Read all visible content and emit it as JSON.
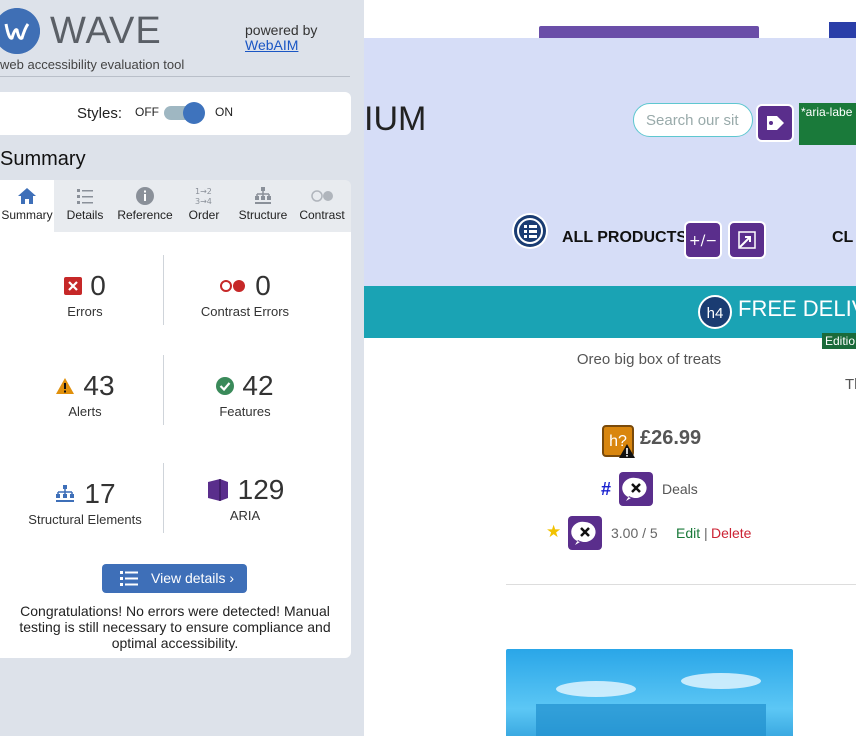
{
  "wave": {
    "title": "WAVE",
    "subtitle": "web accessibility evaluation tool",
    "powered_by": "powered by",
    "powered_by_link": "WebAIM",
    "styles_label": "Styles:",
    "styles_off": "OFF",
    "styles_on": "ON",
    "styles_enabled": true,
    "summary_heading": "Summary",
    "tabs": [
      {
        "label": "Summary",
        "icon": "home-icon",
        "active": true
      },
      {
        "label": "Details",
        "icon": "list-icon"
      },
      {
        "label": "Reference",
        "icon": "info-icon"
      },
      {
        "label": "Order",
        "icon": "order-icon"
      },
      {
        "label": "Structure",
        "icon": "structure-icon"
      },
      {
        "label": "Contrast",
        "icon": "contrast-icon"
      }
    ],
    "stats": {
      "errors": {
        "value": "0",
        "label": "Errors"
      },
      "contrast_errors": {
        "value": "0",
        "label": "Contrast Errors"
      },
      "alerts": {
        "value": "43",
        "label": "Alerts"
      },
      "features": {
        "value": "42",
        "label": "Features"
      },
      "structural": {
        "value": "17",
        "label": "Structural Elements"
      },
      "aria": {
        "value": "129",
        "label": "ARIA"
      }
    },
    "view_details": "View details ›",
    "congrats": "Congratulations! No errors were detected! Manual testing is still necessary to ensure compliance and optimal accessibility."
  },
  "site": {
    "brand_partial": "IUM",
    "search_placeholder": "Search our sit",
    "aria_label_chip": "*aria-labe",
    "nav_all_products": "ALL PRODUCTS",
    "nav_partial": "CL",
    "delivery_text": "FREE DELIV",
    "h4_badge": "h4",
    "edition_partial": "Editio",
    "product_name": "Oreo big box of treats",
    "th_partial": "Th",
    "h_badge": "h?",
    "price": "£26.99",
    "hash": "#",
    "deals": "Deals",
    "rating": "3.00 / 5",
    "edit": "Edit",
    "separator": "|",
    "delete": "Delete"
  },
  "colors": {
    "wave_blue": "#3e6fb8",
    "panel_bg": "#dde2ea",
    "site_header": "#d6ddf7",
    "delivery_bar": "#1aa3b4",
    "error_red": "#c62828",
    "alert_orange": "#e0900c",
    "feature_green": "#3a8a5a",
    "aria_purple": "#5a2e8c"
  }
}
